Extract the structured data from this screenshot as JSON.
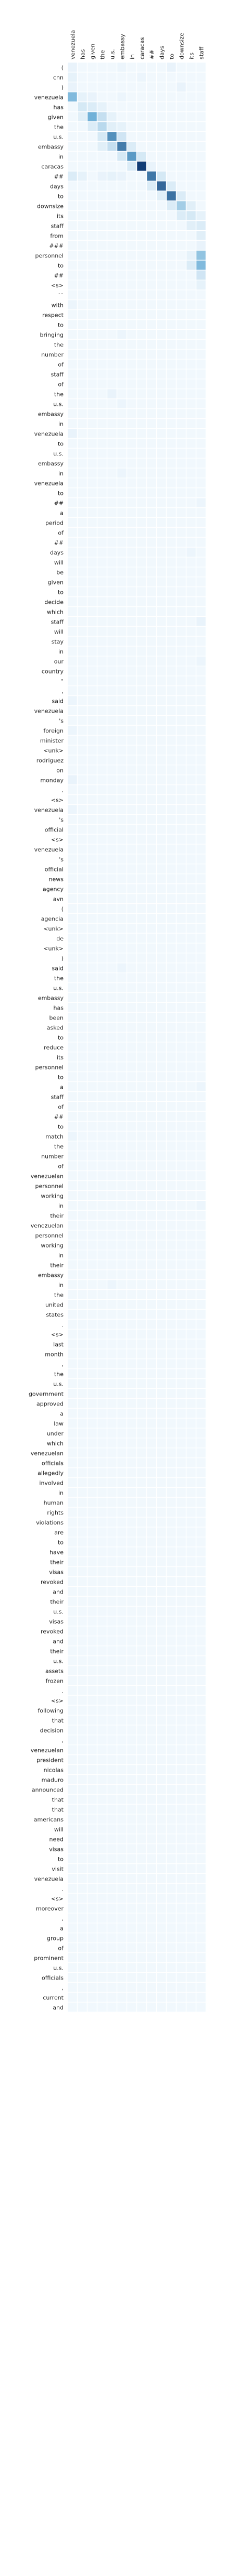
{
  "chart_data": {
    "type": "heatmap",
    "x_labels": [
      "venezuela",
      "has",
      "given",
      "the",
      "u.s.",
      "embassy",
      "in",
      "caracas",
      "##",
      "days",
      "to",
      "downsize",
      "its",
      "staff"
    ],
    "y_labels": [
      "(",
      "cnn",
      ")",
      "venezuela",
      "has",
      "given",
      "the",
      "u.s.",
      "embassy",
      "in",
      "caracas",
      "##",
      "days",
      "to",
      "downsize",
      "its",
      "staff",
      "from",
      "###",
      "personnel",
      "to",
      "##",
      "<s>",
      "``",
      "with",
      "respect",
      "to",
      "bringing",
      "the",
      "number",
      "of",
      "staff",
      "of",
      "the",
      "u.s.",
      "embassy",
      "in",
      "venezuela",
      "to",
      "u.s.",
      "embassy",
      "in",
      "venezuela",
      "to",
      "##",
      "a",
      "period",
      "of",
      "##",
      "days",
      "will",
      "be",
      "given",
      "to",
      "decide",
      "which",
      "staff",
      "will",
      "stay",
      "in",
      "our",
      "country",
      "''",
      ",",
      "said",
      "venezuela",
      "'s",
      "foreign",
      "minister",
      "<unk>",
      "rodriguez",
      "on",
      "monday",
      ".",
      "<s>",
      "venezuela",
      "'s",
      "official",
      "<s>",
      "venezuela",
      "'s",
      "official",
      "news",
      "agency",
      "avn",
      "(",
      "agencia",
      "<unk>",
      "de",
      "<unk>",
      ")",
      "said",
      "the",
      "u.s.",
      "embassy",
      "has",
      "been",
      "asked",
      "to",
      "reduce",
      "its",
      "personnel",
      "to",
      "a",
      "staff",
      "of",
      "##",
      "to",
      "match",
      "the",
      "number",
      "of",
      "venezuelan",
      "personnel",
      "working",
      "in",
      "their",
      "venezuelan",
      "personnel",
      "working",
      "in",
      "their",
      "embassy",
      "in",
      "the",
      "united",
      "states",
      ".",
      "<s>",
      "last",
      "month",
      ",",
      "the",
      "u.s.",
      "government",
      "approved",
      "a",
      "law",
      "under",
      "which",
      "venezuelan",
      "officials",
      "allegedly",
      "involved",
      "in",
      "human",
      "rights",
      "violations",
      "are",
      "to",
      "have",
      "their",
      "visas",
      "revoked",
      "and",
      "their",
      "u.s.",
      "visas",
      "revoked",
      "and",
      "their",
      "u.s.",
      "assets",
      "frozen",
      ".",
      "<s>",
      "following",
      "that",
      "decision",
      ",",
      "venezuelan",
      "president",
      "nicolas",
      "maduro",
      "announced",
      "that",
      "that",
      "americans",
      "will",
      "need",
      "visas",
      "to",
      "visit",
      "venezuela",
      ".",
      "<s>",
      "moreover",
      ",",
      "a",
      "group",
      "of",
      "prominent",
      "u.s.",
      "officials",
      ",",
      "current",
      "and"
    ],
    "values_note": "attention weights 0-1; rows listed = y_labels index; unlisted cells ~0.02",
    "cells": [
      {
        "r": 0,
        "c": 0,
        "v": 0.05
      },
      {
        "r": 0,
        "c": 5,
        "v": 0.04
      },
      {
        "r": 0,
        "c": 10,
        "v": 0.05
      },
      {
        "r": 1,
        "c": 0,
        "v": 0.06
      },
      {
        "r": 1,
        "c": 7,
        "v": 0.04
      },
      {
        "r": 2,
        "c": 0,
        "v": 0.05
      },
      {
        "r": 2,
        "c": 11,
        "v": 0.05
      },
      {
        "r": 3,
        "c": 0,
        "v": 0.42
      },
      {
        "r": 3,
        "c": 1,
        "v": 0.06
      },
      {
        "r": 3,
        "c": 2,
        "v": 0.05
      },
      {
        "r": 3,
        "c": 5,
        "v": 0.04
      },
      {
        "r": 4,
        "c": 1,
        "v": 0.12
      },
      {
        "r": 4,
        "c": 2,
        "v": 0.1
      },
      {
        "r": 4,
        "c": 3,
        "v": 0.06
      },
      {
        "r": 5,
        "c": 1,
        "v": 0.08
      },
      {
        "r": 5,
        "c": 2,
        "v": 0.48
      },
      {
        "r": 5,
        "c": 3,
        "v": 0.18
      },
      {
        "r": 5,
        "c": 4,
        "v": 0.06
      },
      {
        "r": 6,
        "c": 2,
        "v": 0.1
      },
      {
        "r": 6,
        "c": 3,
        "v": 0.22
      },
      {
        "r": 6,
        "c": 4,
        "v": 0.08
      },
      {
        "r": 6,
        "c": 5,
        "v": 0.06
      },
      {
        "r": 7,
        "c": 3,
        "v": 0.12
      },
      {
        "r": 7,
        "c": 4,
        "v": 0.62
      },
      {
        "r": 7,
        "c": 5,
        "v": 0.14
      },
      {
        "r": 8,
        "c": 3,
        "v": 0.08
      },
      {
        "r": 8,
        "c": 4,
        "v": 0.18
      },
      {
        "r": 8,
        "c": 5,
        "v": 0.7
      },
      {
        "r": 8,
        "c": 6,
        "v": 0.1
      },
      {
        "r": 9,
        "c": 5,
        "v": 0.12
      },
      {
        "r": 9,
        "c": 6,
        "v": 0.58
      },
      {
        "r": 9,
        "c": 7,
        "v": 0.12
      },
      {
        "r": 10,
        "c": 6,
        "v": 0.1
      },
      {
        "r": 10,
        "c": 7,
        "v": 0.95
      },
      {
        "r": 10,
        "c": 8,
        "v": 0.05
      },
      {
        "r": 11,
        "c": 0,
        "v": 0.1
      },
      {
        "r": 11,
        "c": 1,
        "v": 0.06
      },
      {
        "r": 11,
        "c": 3,
        "v": 0.05
      },
      {
        "r": 11,
        "c": 4,
        "v": 0.06
      },
      {
        "r": 11,
        "c": 5,
        "v": 0.05
      },
      {
        "r": 11,
        "c": 8,
        "v": 0.72
      },
      {
        "r": 11,
        "c": 9,
        "v": 0.12
      },
      {
        "r": 12,
        "c": 8,
        "v": 0.1
      },
      {
        "r": 12,
        "c": 9,
        "v": 0.78
      },
      {
        "r": 12,
        "c": 10,
        "v": 0.1
      },
      {
        "r": 13,
        "c": 9,
        "v": 0.08
      },
      {
        "r": 13,
        "c": 10,
        "v": 0.74
      },
      {
        "r": 13,
        "c": 11,
        "v": 0.1
      },
      {
        "r": 14,
        "c": 10,
        "v": 0.1
      },
      {
        "r": 14,
        "c": 11,
        "v": 0.3
      },
      {
        "r": 14,
        "c": 12,
        "v": 0.08
      },
      {
        "r": 15,
        "c": 11,
        "v": 0.1
      },
      {
        "r": 15,
        "c": 12,
        "v": 0.12
      },
      {
        "r": 15,
        "c": 13,
        "v": 0.06
      },
      {
        "r": 16,
        "c": 12,
        "v": 0.08
      },
      {
        "r": 16,
        "c": 13,
        "v": 0.1
      },
      {
        "r": 17,
        "c": 13,
        "v": 0.08
      },
      {
        "r": 18,
        "c": 13,
        "v": 0.05
      },
      {
        "r": 19,
        "c": 12,
        "v": 0.06
      },
      {
        "r": 19,
        "c": 13,
        "v": 0.36
      },
      {
        "r": 20,
        "c": 12,
        "v": 0.1
      },
      {
        "r": 20,
        "c": 13,
        "v": 0.42
      },
      {
        "r": 21,
        "c": 13,
        "v": 0.14
      },
      {
        "r": 22,
        "c": 13,
        "v": 0.06
      },
      {
        "r": 24,
        "c": 0,
        "v": 0.04
      },
      {
        "r": 27,
        "c": 5,
        "v": 0.04
      },
      {
        "r": 33,
        "c": 4,
        "v": 0.05
      },
      {
        "r": 34,
        "c": 5,
        "v": 0.04
      },
      {
        "r": 37,
        "c": 0,
        "v": 0.05
      },
      {
        "r": 41,
        "c": 5,
        "v": 0.04
      },
      {
        "r": 44,
        "c": 13,
        "v": 0.04
      },
      {
        "r": 49,
        "c": 12,
        "v": 0.04
      },
      {
        "r": 56,
        "c": 13,
        "v": 0.05
      },
      {
        "r": 60,
        "c": 13,
        "v": 0.04
      },
      {
        "r": 64,
        "c": 0,
        "v": 0.04
      },
      {
        "r": 67,
        "c": 0,
        "v": 0.04
      },
      {
        "r": 72,
        "c": 0,
        "v": 0.05
      },
      {
        "r": 75,
        "c": 0,
        "v": 0.04
      },
      {
        "r": 91,
        "c": 5,
        "v": 0.04
      },
      {
        "r": 103,
        "c": 13,
        "v": 0.04
      },
      {
        "r": 108,
        "c": 0,
        "v": 0.04
      },
      {
        "r": 115,
        "c": 13,
        "v": 0.04
      },
      {
        "r": 123,
        "c": 4,
        "v": 0.04
      }
    ],
    "default_value": 0.02,
    "color_scale": {
      "low": "#f7fbff",
      "high": "#08306b"
    },
    "grid": true
  }
}
